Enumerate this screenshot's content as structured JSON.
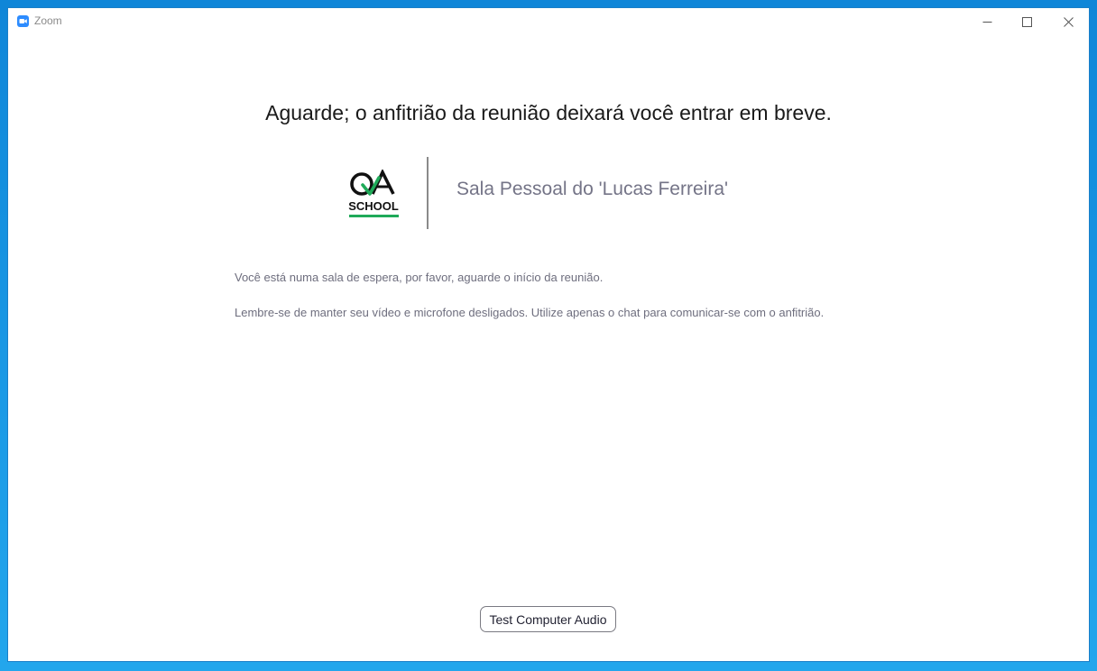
{
  "window": {
    "title": "Zoom",
    "icon": "zoom-camera-icon",
    "controls": {
      "minimize_icon": "minimize-icon",
      "maximize_icon": "maximize-icon",
      "close_icon": "close-icon"
    }
  },
  "waiting_room": {
    "headline": "Aguarde; o anfitrião da reunião deixará você entrar em breve.",
    "logo": {
      "top_text": "QA",
      "bottom_text": "SCHOOL",
      "accent_color": "#1faa59"
    },
    "room_name": "Sala Pessoal do 'Lucas Ferreira'",
    "messages": [
      "Você está numa sala de espera, por favor, aguarde o início da reunião.",
      "Lembre-se de manter seu vídeo e microfone desligados. Utilize apenas o chat para comunicar-se com o anfitrião."
    ],
    "test_audio_label": "Test Computer Audio"
  },
  "colors": {
    "desktop_background": "#1b9ae6",
    "zoom_blue": "#2d8cff"
  }
}
